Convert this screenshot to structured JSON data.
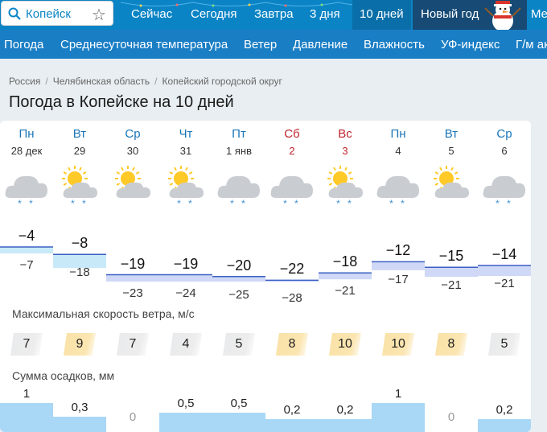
{
  "search": {
    "value": "Копейск"
  },
  "top_nav": [
    "Сейчас",
    "Сегодня",
    "Завтра",
    "3 дня",
    "10 дней"
  ],
  "new_year": "Новый год",
  "top_more": "Ме",
  "sub_nav": [
    "Погода",
    "Среднесуточная температура",
    "Ветер",
    "Давление",
    "Влажность",
    "УФ-индекс",
    "Г/м ак"
  ],
  "breadcrumb": [
    "Россия",
    "Челябинская область",
    "Копейский городской округ"
  ],
  "title": "Погода в Копейске на 10 дней",
  "days": [
    {
      "name": "Пн",
      "date": "28 дек",
      "icon": "cloud-snow",
      "snow": "* *",
      "max": "−4",
      "min": "−7",
      "maxv": -4,
      "minv": -7,
      "wind": "7",
      "wind_level": "gray",
      "precip": "1",
      "precip_v": 1.0,
      "weekend": false
    },
    {
      "name": "Вт",
      "date": "29",
      "icon": "sun-cloud-snow",
      "snow": "* *",
      "max": "−8",
      "min": "−18",
      "maxv": -8,
      "minv": -18,
      "wind": "9",
      "wind_level": "yellow",
      "precip": "0,3",
      "precip_v": 0.3,
      "weekend": false
    },
    {
      "name": "Ср",
      "date": "30",
      "icon": "sun-cloud",
      "snow": "",
      "max": "−19",
      "min": "−23",
      "maxv": -19,
      "minv": -23,
      "wind": "7",
      "wind_level": "gray",
      "precip": "0",
      "precip_v": 0,
      "weekend": false
    },
    {
      "name": "Чт",
      "date": "31",
      "icon": "sun-cloud-snow",
      "snow": "* *",
      "max": "−19",
      "min": "−24",
      "maxv": -19,
      "minv": -24,
      "wind": "4",
      "wind_level": "gray",
      "precip": "0,5",
      "precip_v": 0.5,
      "weekend": false
    },
    {
      "name": "Пт",
      "date": "1 янв",
      "icon": "cloud-snow",
      "snow": "* *",
      "max": "−20",
      "min": "−25",
      "maxv": -20,
      "minv": -25,
      "wind": "5",
      "wind_level": "gray",
      "precip": "0,5",
      "precip_v": 0.5,
      "weekend": false
    },
    {
      "name": "Сб",
      "date": "2",
      "icon": "cloud-snow",
      "snow": "* *",
      "max": "−22",
      "min": "−28",
      "maxv": -22,
      "minv": -28,
      "wind": "8",
      "wind_level": "yellow",
      "precip": "0,2",
      "precip_v": 0.2,
      "weekend": true
    },
    {
      "name": "Вс",
      "date": "3",
      "icon": "sun-cloud-snow",
      "snow": "* *",
      "max": "−18",
      "min": "−21",
      "maxv": -18,
      "minv": -21,
      "wind": "10",
      "wind_level": "yellow",
      "precip": "0,2",
      "precip_v": 0.2,
      "weekend": true
    },
    {
      "name": "Пн",
      "date": "4",
      "icon": "cloud-snow",
      "snow": "* *",
      "max": "−12",
      "min": "−17",
      "maxv": -12,
      "minv": -17,
      "wind": "10",
      "wind_level": "yellow",
      "precip": "1",
      "precip_v": 1.0,
      "weekend": false
    },
    {
      "name": "Вт",
      "date": "5",
      "icon": "sun-cloud",
      "snow": "",
      "max": "−15",
      "min": "−21",
      "maxv": -15,
      "minv": -21,
      "wind": "8",
      "wind_level": "yellow",
      "precip": "0",
      "precip_v": 0,
      "weekend": false
    },
    {
      "name": "Ср",
      "date": "6",
      "icon": "cloud-snow",
      "snow": "* *",
      "max": "−14",
      "min": "−21",
      "maxv": -14,
      "minv": -21,
      "wind": "5",
      "wind_level": "gray",
      "precip": "0,2",
      "precip_v": 0.2,
      "weekend": false
    }
  ],
  "wind_label": "Максимальная скорость ветра, м/с",
  "precip_label": "Сумма осадков, мм",
  "colors": {
    "topbar": "#0b84c6",
    "subbar": "#1a7ec5",
    "weekend": "#c0232c",
    "dayname": "#1b76b8",
    "precip_bar": "#a9d7f6"
  }
}
